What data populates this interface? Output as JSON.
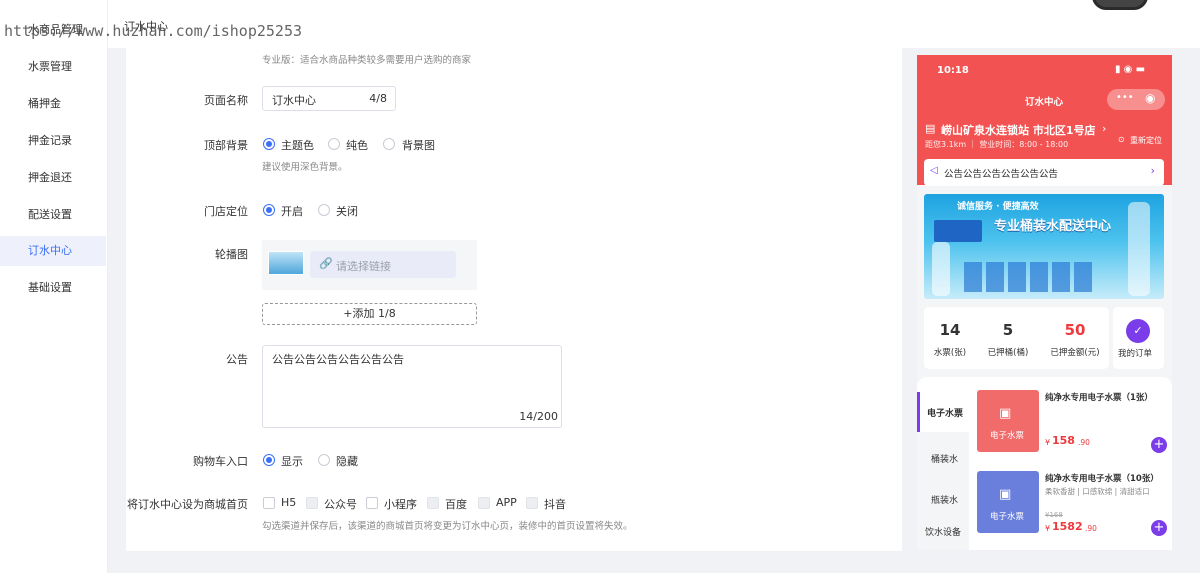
{
  "watermark": "https://www.huzhan.com/ishop25253",
  "topbar": {
    "title": "订水中心"
  },
  "sidebar": {
    "items": [
      {
        "label": "水商品管理"
      },
      {
        "label": "水票管理"
      },
      {
        "label": "桶押金"
      },
      {
        "label": "押金记录"
      },
      {
        "label": "押金退还"
      },
      {
        "label": "配送设置"
      },
      {
        "label": "订水中心",
        "active": true
      },
      {
        "label": "基础设置"
      }
    ]
  },
  "form": {
    "edition_hint": "专业版：适合水商品种类较多需要用户选购的商家",
    "page_name": {
      "label": "页面名称",
      "value": "订水中心",
      "count": "4/8"
    },
    "background": {
      "label": "顶部背景",
      "options": [
        "主题色",
        "纯色",
        "背景图"
      ],
      "selected": 0,
      "hint": "建议使用深色背景。"
    },
    "location": {
      "label": "门店定位",
      "options": [
        "开启",
        "关闭"
      ],
      "selected": 0
    },
    "carousel": {
      "label": "轮播图",
      "link_placeholder": "请选择链接",
      "add_label": "+添加 1/8"
    },
    "notice": {
      "label": "公告",
      "value": "公告公告公告公告公告公告",
      "count": "14/200"
    },
    "cart": {
      "label": "购物车入口",
      "options": [
        "显示",
        "隐藏"
      ],
      "selected": 0
    },
    "homepage": {
      "label": "将订水中心设为商城首页",
      "channels": [
        {
          "name": "H5",
          "disabled": false
        },
        {
          "name": "公众号",
          "disabled": true
        },
        {
          "name": "小程序",
          "disabled": false
        },
        {
          "name": "百度",
          "disabled": true
        },
        {
          "name": "APP",
          "disabled": true
        },
        {
          "name": "抖音",
          "disabled": true
        }
      ],
      "hint": "勾选渠道并保存后，该渠道的商城首页将变更为订水中心页，装修中的首页设置将失效。"
    }
  },
  "phone": {
    "time": "10:18",
    "nav_title": "订水中心",
    "store_name": "崂山矿泉水连锁站 市北区1号店",
    "store_meta": "距您3.1km ｜ 营业时间：8:00 - 18:00",
    "relocate": "重新定位",
    "notice": "公告公告公告公告公告公告",
    "banner_top": "诚信服务 · 便捷高效",
    "banner_main": "专业桶装水配送中心",
    "stats": [
      {
        "value": "14",
        "label": "水票(张)",
        "color": "#333333"
      },
      {
        "value": "5",
        "label": "已押桶(桶)",
        "color": "#333333"
      },
      {
        "value": "50",
        "label": "已押金额(元)",
        "color": "#f0393c"
      }
    ],
    "my_orders": "我的订单",
    "categories": [
      "电子水票",
      "桶装水",
      "瓶装水",
      "饮水设备"
    ],
    "products": [
      {
        "image_label": "电子水票",
        "title": "纯净水专用电子水票（1张）",
        "tags": "",
        "orig_price": "",
        "price": "158",
        "price_dec": ".90",
        "color": "#f26b6b"
      },
      {
        "image_label": "电子水票",
        "title": "纯净水专用电子水票（10张）",
        "tags": "柔软香甜 | 口感软绵 | 清甜适口",
        "orig_price": "¥168",
        "price": "1582",
        "price_dec": ".90",
        "color": "#6a7fdc"
      }
    ],
    "currency": "¥"
  },
  "colors": {
    "accent": "#3a6ff7",
    "phone_red": "#f25352",
    "purple": "#7b3ce9"
  }
}
